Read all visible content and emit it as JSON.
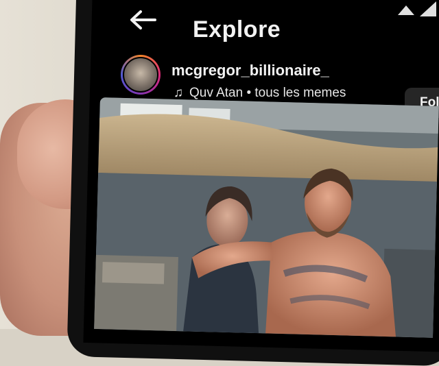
{
  "header": {
    "title": "Explore"
  },
  "post": {
    "username": "mcgregor_billionaire_",
    "audio": "Quv Atan • tous les memes",
    "follow_label": "Fol"
  },
  "icons": {
    "back": "back-arrow-icon",
    "music": "music-note-icon",
    "wifi": "wifi-icon",
    "signal": "signal-icon"
  },
  "colors": {
    "screen_bg": "#000000",
    "text": "#f2f2f2",
    "button_bg": "#262626",
    "avatar_ring": [
      "#f58529",
      "#dd2a7b",
      "#8134af",
      "#515bd4"
    ]
  }
}
